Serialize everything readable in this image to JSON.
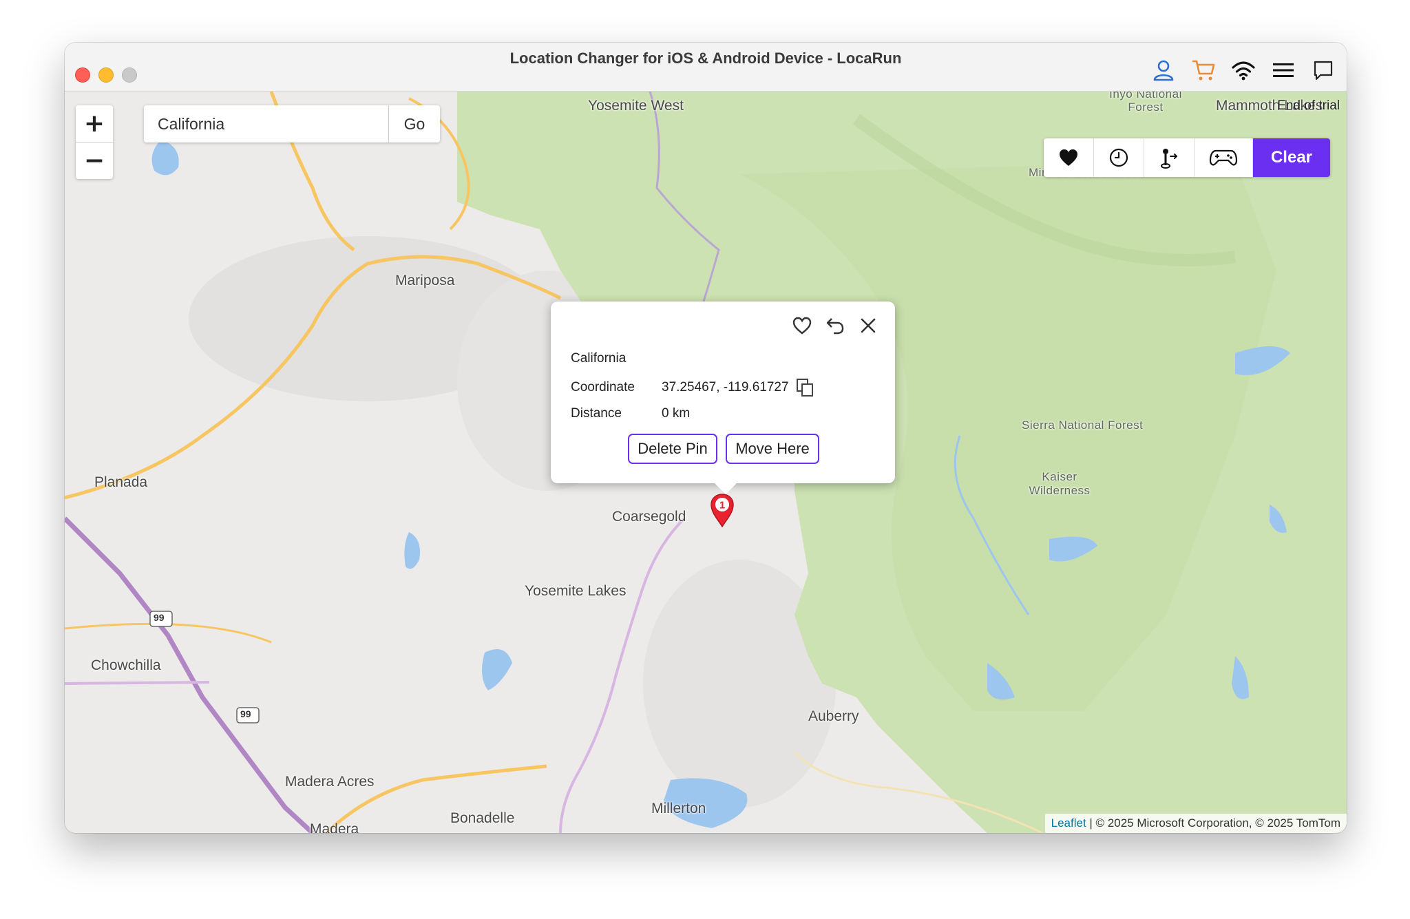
{
  "window": {
    "title": "Location Changer for iOS & Android Device - LocaRun"
  },
  "titlebar_icons": [
    "user-icon",
    "cart-icon",
    "wifi-icon",
    "menu-icon",
    "chat-icon"
  ],
  "colors": {
    "accent": "#6a2ff0",
    "pin": "#e8232f",
    "forest": "#cde2b2",
    "land": "#ecebea",
    "road": "#f7c663",
    "highway": "#b087c4",
    "water": "#9dc6ef"
  },
  "search": {
    "value": "California",
    "go_label": "Go"
  },
  "zoom": {
    "in_label": "+",
    "out_label": "−"
  },
  "toolbar": {
    "icons": [
      "heart-icon",
      "clock-icon",
      "joystick-icon",
      "gamepad-icon"
    ],
    "clear_label": "Clear"
  },
  "trial_text": "End of trial",
  "map_labels": {
    "yosemite_west": "Yosemite West",
    "inyo_forest": "Inyo National Forest",
    "mammoth": "Mammoth Lakes",
    "minarets": "Minarets Wilderness",
    "mariposa": "Mariposa",
    "sierra": "Sierra National Forest",
    "kaiser": "Kaiser Wilderness",
    "planada": "Planada",
    "coarsegold": "Coarsegold",
    "yosemite_lakes": "Yosemite Lakes",
    "chowchilla": "Chowchilla",
    "auberry": "Auberry",
    "madera_acres": "Madera Acres",
    "madera": "Madera",
    "bonadelle": "Bonadelle",
    "millerton": "Millerton",
    "hwy_99_a": "99",
    "hwy_99_b": "99"
  },
  "popup": {
    "icons": [
      "heart-outline-icon",
      "undo-icon",
      "close-icon"
    ],
    "name": "California",
    "coordinate_label": "Coordinate",
    "coordinate_value": "37.25467, -119.61727",
    "distance_label": "Distance",
    "distance_value": "0 km",
    "delete_label": "Delete Pin",
    "move_label": "Move Here"
  },
  "pin": {
    "number": "1"
  },
  "attribution": {
    "leaflet": "Leaflet",
    "rest": " | © 2025 Microsoft Corporation, © 2025 TomTom"
  }
}
